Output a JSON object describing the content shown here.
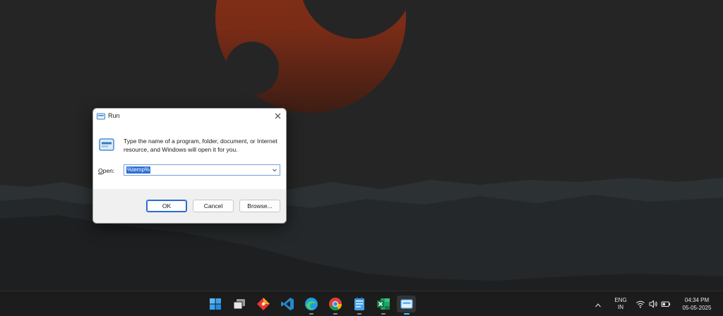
{
  "dialog": {
    "title": "Run",
    "description": "Type the name of a program, folder, document, or Internet resource, and Windows will open it for you.",
    "open_label_accel": "O",
    "open_label_rest": "pen:",
    "open_value": "%temp%",
    "ok_label": "OK",
    "cancel_label": "Cancel",
    "browse_label": "Browse..."
  },
  "taskbar": {
    "apps": [
      "windows-start",
      "task-view",
      "git-app",
      "vs-code",
      "edge",
      "chrome",
      "notepad",
      "excel",
      "run"
    ],
    "language_top": "ENG",
    "language_bottom": "IN",
    "time": "04:34 PM",
    "date": "05-05-2025"
  },
  "colors": {
    "accent": "#2b6cd4",
    "sun": "#9a3517",
    "taskbar": "#1c1c1c"
  }
}
